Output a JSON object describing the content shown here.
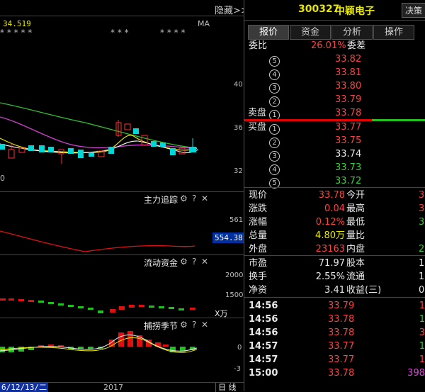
{
  "left": {
    "hide_label": "隐藏>>",
    "ma_label": "MA",
    "ma_value": "34.519",
    "stars_a": "* * * * *",
    "stars_b": "* * *",
    "stars_c": "* * * *",
    "price_axis": [
      "40",
      "36",
      "32"
    ],
    "left_axis_fragment": "0",
    "zhuli": {
      "title": "主力追踪",
      "axis_top": "561",
      "badge": "554.38"
    },
    "liudong": {
      "title": "流动资金",
      "axis": [
        "2000",
        "1500"
      ],
      "unit": "X万"
    },
    "bulao": {
      "title": "捕捞季节",
      "axis": [
        "0",
        "-3"
      ]
    },
    "date_left": "6/12/13/二",
    "date_year": "2017",
    "period_label": "日 线",
    "panel_icons": {
      "gear": "⚙",
      "question": "?",
      "close": "✕"
    }
  },
  "right": {
    "stock_code": "300327",
    "stock_name": "中颖电子",
    "decision_button": "决策",
    "tabs": [
      "报价",
      "资金",
      "分析",
      "操作"
    ],
    "weibi_label": "委比",
    "weibi_value": "26.01%",
    "weicha_label": "委差",
    "sell_label": "卖盘",
    "buy_label": "买盘",
    "sell_levels": [
      {
        "n": "5",
        "price": "33.82"
      },
      {
        "n": "4",
        "price": "33.81"
      },
      {
        "n": "3",
        "price": "33.80"
      },
      {
        "n": "2",
        "price": "33.79"
      },
      {
        "n": "1",
        "price": "33.78"
      }
    ],
    "buy_levels": [
      {
        "n": "1",
        "price": "33.77",
        "color": "red"
      },
      {
        "n": "2",
        "price": "33.75",
        "color": "red"
      },
      {
        "n": "3",
        "price": "33.74",
        "color": "white"
      },
      {
        "n": "4",
        "price": "33.73",
        "color": "green"
      },
      {
        "n": "5",
        "price": "33.72",
        "color": "green"
      }
    ],
    "stats": [
      {
        "l": "现价",
        "v": "33.78",
        "vc": "red",
        "l2": "今开",
        "v2": "3",
        "v2c": "red"
      },
      {
        "l": "涨跌",
        "v": "0.04",
        "vc": "red",
        "l2": "最高",
        "v2": "3",
        "v2c": "red"
      },
      {
        "l": "涨幅",
        "v": "0.12%",
        "vc": "red",
        "l2": "最低",
        "v2": "3",
        "v2c": "green"
      },
      {
        "l": "总量",
        "v": "4.80万",
        "vc": "yellow",
        "l2": "量比",
        "v2": "",
        "v2c": "white"
      },
      {
        "l": "外盘",
        "v": "23163",
        "vc": "red",
        "l2": "内盘",
        "v2": "2",
        "v2c": "green"
      }
    ],
    "fund": [
      {
        "l": "市盈",
        "v": "71.97",
        "l2": "股本",
        "v2": "1."
      },
      {
        "l": "换手",
        "v": "2.55%",
        "l2": "流通",
        "v2": "1."
      },
      {
        "l": "净资",
        "v": "3.41",
        "l2": "收益(三)",
        "v2": "0"
      }
    ],
    "ticks": [
      {
        "t": "14:56",
        "p": "33.79",
        "pc": "red",
        "v": "1",
        "vc": "red"
      },
      {
        "t": "14:56",
        "p": "33.78",
        "pc": "red",
        "v": "1",
        "vc": "green"
      },
      {
        "t": "14:56",
        "p": "33.78",
        "pc": "red",
        "v": "3",
        "vc": "red"
      },
      {
        "t": "14:57",
        "p": "33.77",
        "pc": "red",
        "v": "1",
        "vc": "green"
      },
      {
        "t": "14:57",
        "p": "33.77",
        "pc": "red",
        "v": "1",
        "vc": "red"
      },
      {
        "t": "15:00",
        "p": "33.78",
        "pc": "red",
        "v": "398",
        "vc": "magenta"
      }
    ]
  }
}
